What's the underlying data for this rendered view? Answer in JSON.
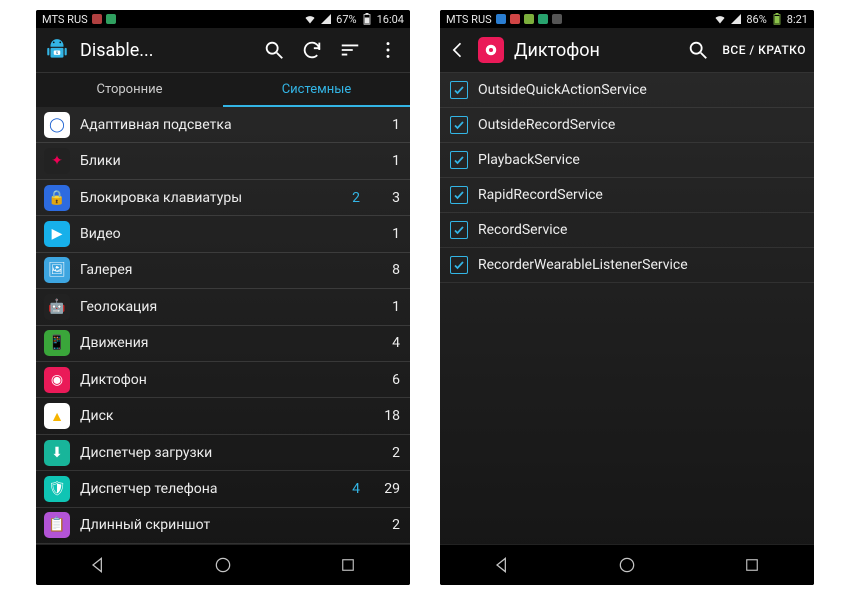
{
  "phone1": {
    "status": {
      "carrier": "MTS RUS",
      "battery": "67%",
      "time": "16:04"
    },
    "appbar": {
      "title": "Disable..."
    },
    "tabs": {
      "thirdparty": "Сторонние",
      "system": "Системные"
    },
    "rows": [
      {
        "label": "Адаптивная подсветка",
        "count": "1",
        "blue": "",
        "iconBg": "#ffffff",
        "glyph": "◯",
        "glyphColor": "#1e62d0"
      },
      {
        "label": "Блики",
        "count": "1",
        "blue": "",
        "iconBg": "#222",
        "glyph": "✦",
        "glyphColor": "#e05"
      },
      {
        "label": "Блокировка клавиатуры",
        "count": "3",
        "blue": "2",
        "iconBg": "#2d6be0",
        "glyph": "🔒",
        "glyphColor": "#fff"
      },
      {
        "label": "Видео",
        "count": "1",
        "blue": "",
        "iconBg": "#17b0ea",
        "glyph": "▶",
        "glyphColor": "#fff"
      },
      {
        "label": "Галерея",
        "count": "8",
        "blue": "",
        "iconBg": "#3da5e0",
        "glyph": "🖼",
        "glyphColor": "#fff"
      },
      {
        "label": "Геолокация",
        "count": "1",
        "blue": "",
        "iconBg": "#222",
        "glyph": "🤖",
        "glyphColor": "#a4c639"
      },
      {
        "label": "Движения",
        "count": "4",
        "blue": "",
        "iconBg": "#3aa63a",
        "glyph": "📱",
        "glyphColor": "#fff"
      },
      {
        "label": "Диктофон",
        "count": "6",
        "blue": "",
        "iconBg": "#ea1a58",
        "glyph": "◉",
        "glyphColor": "#fff"
      },
      {
        "label": "Диск",
        "count": "18",
        "blue": "",
        "iconBg": "#fff",
        "glyph": "▲",
        "glyphColor": "#f6b400"
      },
      {
        "label": "Диспетчер загрузки",
        "count": "2",
        "blue": "",
        "iconBg": "#18b59a",
        "glyph": "⬇",
        "glyphColor": "#fff"
      },
      {
        "label": "Диспетчер телефона",
        "count": "29",
        "blue": "4",
        "iconBg": "#0fc4b4",
        "glyph": "🛡",
        "glyphColor": "#fff"
      },
      {
        "label": "Длинный скриншот",
        "count": "2",
        "blue": "",
        "iconBg": "#b354d6",
        "glyph": "📋",
        "glyphColor": "#fff"
      }
    ]
  },
  "phone2": {
    "status": {
      "carrier": "MTS RUS",
      "battery": "86%",
      "time": "8:21"
    },
    "appbar": {
      "title": "Диктофон",
      "right": "ВСЕ / КРАТКО"
    },
    "services": [
      "OutsideQuickActionService",
      "OutsideRecordService",
      "PlaybackService",
      "RapidRecordService",
      "RecordService",
      "RecorderWearableListenerService"
    ]
  }
}
